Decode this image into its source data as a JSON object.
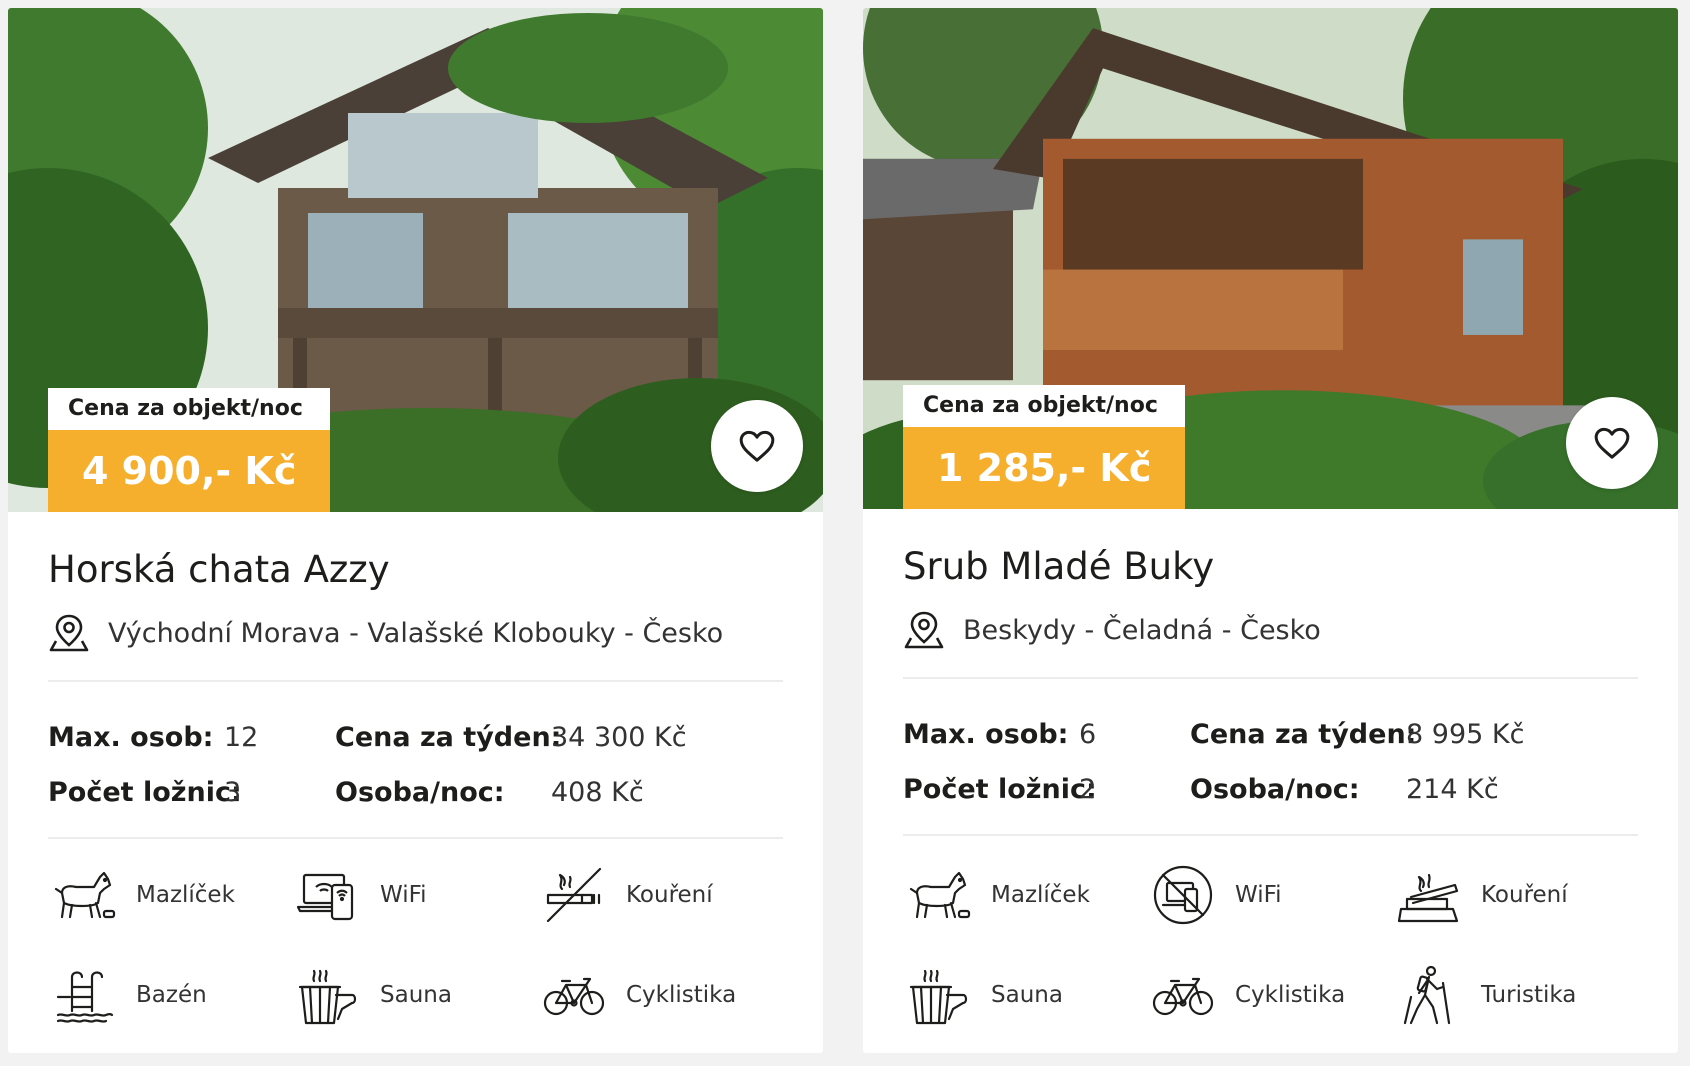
{
  "cards": [
    {
      "price_label": "Cena za objekt/noc",
      "price": "4 900,- Kč",
      "title": "Horská chata Azzy",
      "location": "Východní Morava - Valašské Klobouky - Česko",
      "stats": {
        "max_persons_label": "Max. osob:",
        "max_persons": "12",
        "bedrooms_label": "Počet ložnic:",
        "bedrooms": "3",
        "week_price_label": "Cena za týden:",
        "week_price": "34 300 Kč",
        "person_night_label": "Osoba/noc:",
        "person_night": "408 Kč"
      },
      "amenities": [
        {
          "label": "Mazlíček",
          "icon": "dog-icon"
        },
        {
          "label": "WiFi",
          "icon": "devices-icon"
        },
        {
          "label": "Kouření",
          "icon": "no-smoking-icon"
        },
        {
          "label": "Bazén",
          "icon": "pool-ladder-icon"
        },
        {
          "label": "Sauna",
          "icon": "sauna-bucket-icon"
        },
        {
          "label": "Cyklistika",
          "icon": "bicycle-icon"
        }
      ]
    },
    {
      "price_label": "Cena za objekt/noc",
      "price": "1 285,- Kč",
      "title": "Srub Mladé Buky",
      "location": "Beskydy - Čeladná - Česko",
      "stats": {
        "max_persons_label": "Max. osob:",
        "max_persons": "6",
        "bedrooms_label": "Počet ložnic:",
        "bedrooms": "2",
        "week_price_label": "Cena za týden:",
        "week_price": "8 995 Kč",
        "person_night_label": "Osoba/noc:",
        "person_night": "214 Kč"
      },
      "amenities": [
        {
          "label": "Mazlíček",
          "icon": "dog-icon"
        },
        {
          "label": "WiFi",
          "icon": "no-wifi-icon"
        },
        {
          "label": "Kouření",
          "icon": "smoking-icon"
        },
        {
          "label": "Sauna",
          "icon": "sauna-bucket-icon"
        },
        {
          "label": "Cyklistika",
          "icon": "bicycle-icon"
        },
        {
          "label": "Turistika",
          "icon": "hiker-icon"
        }
      ]
    }
  ],
  "colors": {
    "accent": "#f6ae2d",
    "text": "#1d1d1b",
    "divider": "#ececec"
  }
}
